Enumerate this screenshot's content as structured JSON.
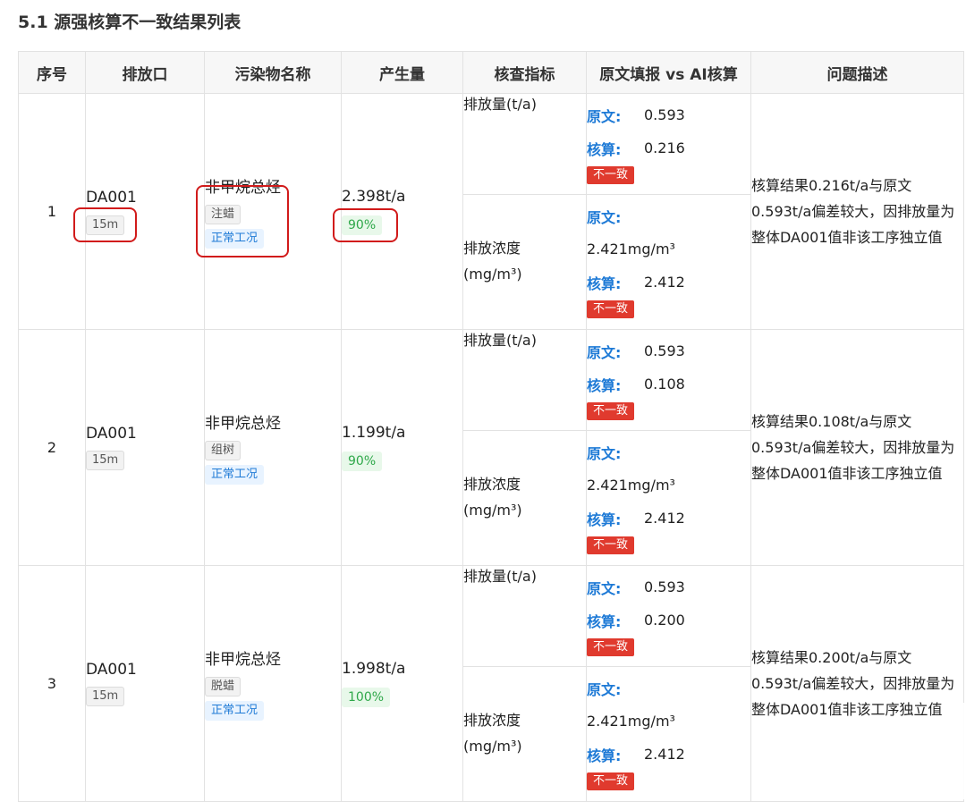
{
  "title": "5.1 源强核算不一致结果列表",
  "headers": [
    "序号",
    "排放口",
    "污染物名称",
    "产生量",
    "核查指标",
    "原文填报 vs AI核算",
    "问题描述"
  ],
  "original_label": "原文:",
  "calc_label": "核算:",
  "mismatch_badge": "不一致",
  "rows": [
    {
      "no": "1",
      "outlet": "DA001",
      "height": "15m",
      "pollutant": "非甲烷总烃",
      "process": "注蜡",
      "condition": "正常工况",
      "production": "2.398t/a",
      "efficiency": "90%",
      "ind_amount": "排放量(t/a)",
      "ind_conc_1": "排放浓度",
      "ind_conc_2": "(mg/m³)",
      "amount_original": "0.593",
      "amount_calc": "0.216",
      "conc_original": "2.421mg/m³",
      "conc_calc": "2.412",
      "description": "核算结果0.216t/a与原文0.593t/a偏差较大，因排放量为整体DA001值非该工序独立值"
    },
    {
      "no": "2",
      "outlet": "DA001",
      "height": "15m",
      "pollutant": "非甲烷总烃",
      "process": "组树",
      "condition": "正常工况",
      "production": "1.199t/a",
      "efficiency": "90%",
      "ind_amount": "排放量(t/a)",
      "ind_conc_1": "排放浓度",
      "ind_conc_2": "(mg/m³)",
      "amount_original": "0.593",
      "amount_calc": "0.108",
      "conc_original": "2.421mg/m³",
      "conc_calc": "2.412",
      "description": "核算结果0.108t/a与原文0.593t/a偏差较大，因排放量为整体DA001值非该工序独立值"
    },
    {
      "no": "3",
      "outlet": "DA001",
      "height": "15m",
      "pollutant": "非甲烷总烃",
      "process": "脱蜡",
      "condition": "正常工况",
      "production": "1.998t/a",
      "efficiency": "100%",
      "ind_amount": "排放量(t/a)",
      "ind_conc_1": "排放浓度",
      "ind_conc_2": "(mg/m³)",
      "amount_original": "0.593",
      "amount_calc": "0.200",
      "conc_original": "2.421mg/m³",
      "conc_calc": "2.412",
      "description": "核算结果0.200t/a与原文0.593t/a偏差较大，因排放量为整体DA001值非该工序独立值"
    }
  ]
}
